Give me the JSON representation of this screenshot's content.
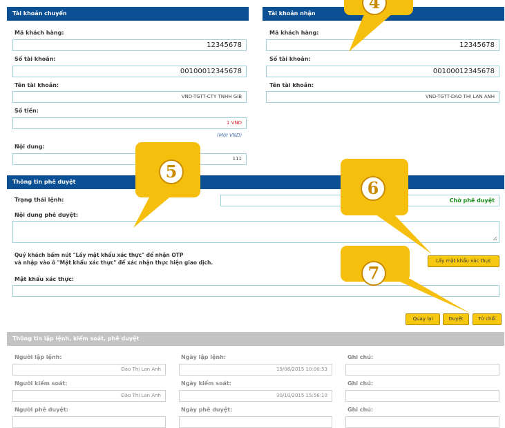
{
  "sender": {
    "header": "Tài khoản chuyển",
    "customer_code_label": "Mã khách hàng:",
    "customer_code": "12345678",
    "account_no_label": "Số tài khoản:",
    "account_no": "00100012345678",
    "account_name_label": "Tên tài khoản:",
    "account_name": "VND-TGTT-CTY TNHH GIB",
    "amount_label": "Số tiền:",
    "amount": "1 VND",
    "amount_words": "(Một VND)",
    "content_label": "Nội dung:",
    "content": "111"
  },
  "receiver": {
    "header": "Tài khoản nhận",
    "customer_code_label": "Mã khách hàng:",
    "customer_code": "12345678",
    "account_no_label": "Số tài khoản:",
    "account_no": "00100012345678",
    "account_name_label": "Tên tài khoản:",
    "account_name": "VND-TGTT-DAO THI LAN ANH"
  },
  "approval": {
    "header": "Thông tin phê duyệt",
    "status_label": "Trạng thái lệnh:",
    "status": "Chờ phê duyệt",
    "content_label": "Nội dung phê duyệt:",
    "instruction_line1": "Quý khách bấm nút \"Lấy mật khẩu xác thực\" để nhận OTP",
    "instruction_line2": "và nhập vào ô \"Mật khẩu xác thực\" để xác nhận thực hiện giao dịch.",
    "otp_button": "Lấy mật khẩu xác thực",
    "otp_label": "Mật khẩu xác thực:",
    "back_button": "Quay lại",
    "approve_button": "Duyệt",
    "reject_button": "Từ chối"
  },
  "history": {
    "header": "Thông tin lập lệnh, kiểm soát, phê duyệt",
    "creator_label": "Người lập lệnh:",
    "creator": "Đào Thị Lan Anh",
    "created_date_label": "Ngày lập lệnh:",
    "created_date": "19/08/2015 10:00:53",
    "note1_label": "Ghi chú:",
    "controller_label": "Người kiểm soát:",
    "controller": "Đào Thị Lan Anh",
    "controlled_date_label": "Ngày kiểm soát:",
    "controlled_date": "30/10/2015 15:56:10",
    "note2_label": "Ghi chú:",
    "approver_label": "Người phê duyệt:",
    "approved_date_label": "Ngày phê duyệt:",
    "note3_label": "Ghi chú:"
  },
  "callouts": {
    "c4": "4",
    "c5": "5",
    "c6": "6",
    "c7": "7"
  },
  "colors": {
    "header_blue": "#0b4f94",
    "header_gray": "#c3c3c3",
    "callout_yellow": "#f6bf0e",
    "button_yellow": "#f6c810",
    "status_green": "#138a13",
    "amount_red": "#d9222a"
  }
}
